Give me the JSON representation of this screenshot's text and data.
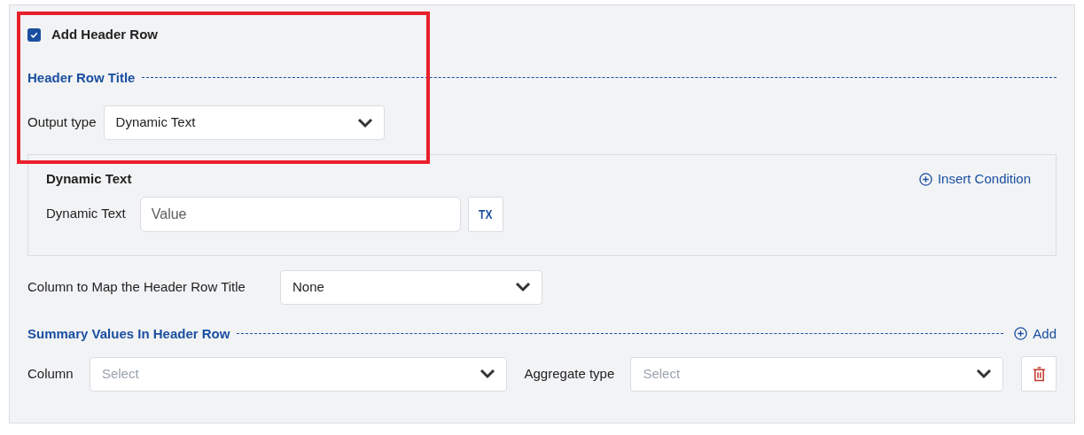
{
  "add_header_row": {
    "label": "Add Header Row",
    "checked": true
  },
  "header_row_title": {
    "title": "Header Row Title",
    "output_type": {
      "label": "Output type",
      "value": "Dynamic Text"
    },
    "dynamic_text_card": {
      "title": "Dynamic Text",
      "insert_condition": "Insert Condition",
      "field": {
        "label": "Dynamic Text",
        "placeholder": "Value"
      },
      "format_button": "TX"
    },
    "column_map": {
      "label": "Column to Map the Header Row Title",
      "value": "None"
    }
  },
  "summary_values": {
    "title": "Summary Values In Header Row",
    "add": "Add",
    "column": {
      "label": "Column",
      "placeholder": "Select"
    },
    "aggregate_type": {
      "label": "Aggregate type",
      "placeholder": "Select"
    }
  },
  "annotation": {
    "kind": "highlight"
  }
}
